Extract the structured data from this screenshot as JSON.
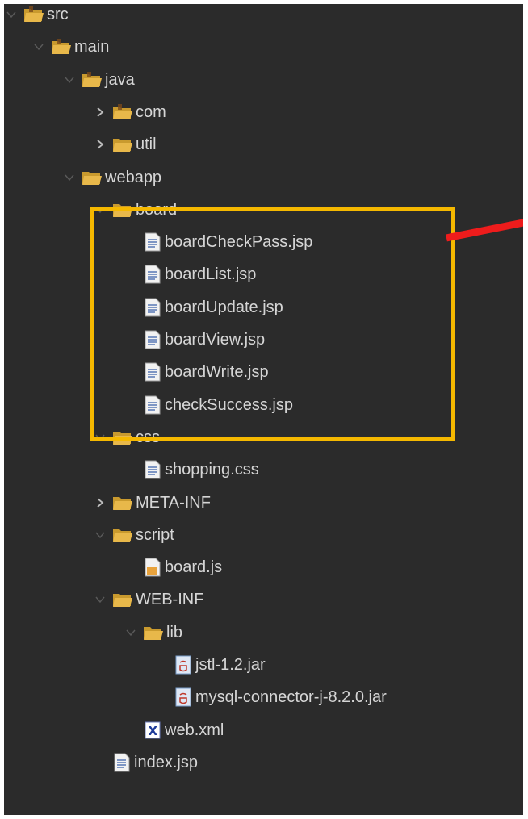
{
  "theme": {
    "background": "#2b2b2b",
    "text": "#d6d6d6",
    "folder_color": "#e8b84a",
    "highlight_border": "#f5b800",
    "arrow_color": "#ee1c1c"
  },
  "tree": [
    {
      "name": "src",
      "type": "package-folder",
      "depth": 0,
      "toggle": "expanded"
    },
    {
      "name": "main",
      "type": "package-folder",
      "depth": 1,
      "toggle": "expanded"
    },
    {
      "name": "java",
      "type": "package-folder",
      "depth": 2,
      "toggle": "expanded"
    },
    {
      "name": "com",
      "type": "package-folder",
      "depth": 3,
      "toggle": "collapsed"
    },
    {
      "name": "util",
      "type": "folder",
      "depth": 3,
      "toggle": "collapsed"
    },
    {
      "name": "webapp",
      "type": "folder",
      "depth": 2,
      "toggle": "expanded"
    },
    {
      "name": "board",
      "type": "folder",
      "depth": 3,
      "toggle": "expanded"
    },
    {
      "name": "boardCheckPass.jsp",
      "type": "jsp-file",
      "depth": 4,
      "toggle": "none"
    },
    {
      "name": "boardList.jsp",
      "type": "jsp-file",
      "depth": 4,
      "toggle": "none"
    },
    {
      "name": "boardUpdate.jsp",
      "type": "jsp-file",
      "depth": 4,
      "toggle": "none"
    },
    {
      "name": "boardView.jsp",
      "type": "jsp-file",
      "depth": 4,
      "toggle": "none"
    },
    {
      "name": "boardWrite.jsp",
      "type": "jsp-file",
      "depth": 4,
      "toggle": "none"
    },
    {
      "name": "checkSuccess.jsp",
      "type": "jsp-file",
      "depth": 4,
      "toggle": "none"
    },
    {
      "name": "css",
      "type": "folder",
      "depth": 3,
      "toggle": "expanded"
    },
    {
      "name": "shopping.css",
      "type": "css-file",
      "depth": 4,
      "toggle": "none"
    },
    {
      "name": "META-INF",
      "type": "folder",
      "depth": 3,
      "toggle": "collapsed"
    },
    {
      "name": "script",
      "type": "folder",
      "depth": 3,
      "toggle": "expanded"
    },
    {
      "name": "board.js",
      "type": "js-file",
      "depth": 4,
      "toggle": "none"
    },
    {
      "name": "WEB-INF",
      "type": "folder",
      "depth": 3,
      "toggle": "expanded"
    },
    {
      "name": "lib",
      "type": "folder",
      "depth": 4,
      "toggle": "expanded"
    },
    {
      "name": "jstl-1.2.jar",
      "type": "jar-file",
      "depth": 5,
      "toggle": "none"
    },
    {
      "name": "mysql-connector-j-8.2.0.jar",
      "type": "jar-file",
      "depth": 5,
      "toggle": "none"
    },
    {
      "name": "web.xml",
      "type": "xml-file",
      "depth": 4,
      "toggle": "none"
    },
    {
      "name": "index.jsp",
      "type": "jsp-file",
      "depth": 3,
      "toggle": "none"
    }
  ],
  "annotations": {
    "highlighted_rows": [
      "board",
      "boardCheckPass.jsp",
      "boardList.jsp",
      "boardUpdate.jsp",
      "boardView.jsp",
      "boardWrite.jsp",
      "checkSuccess.jsp"
    ],
    "arrow": "red-arrow"
  }
}
